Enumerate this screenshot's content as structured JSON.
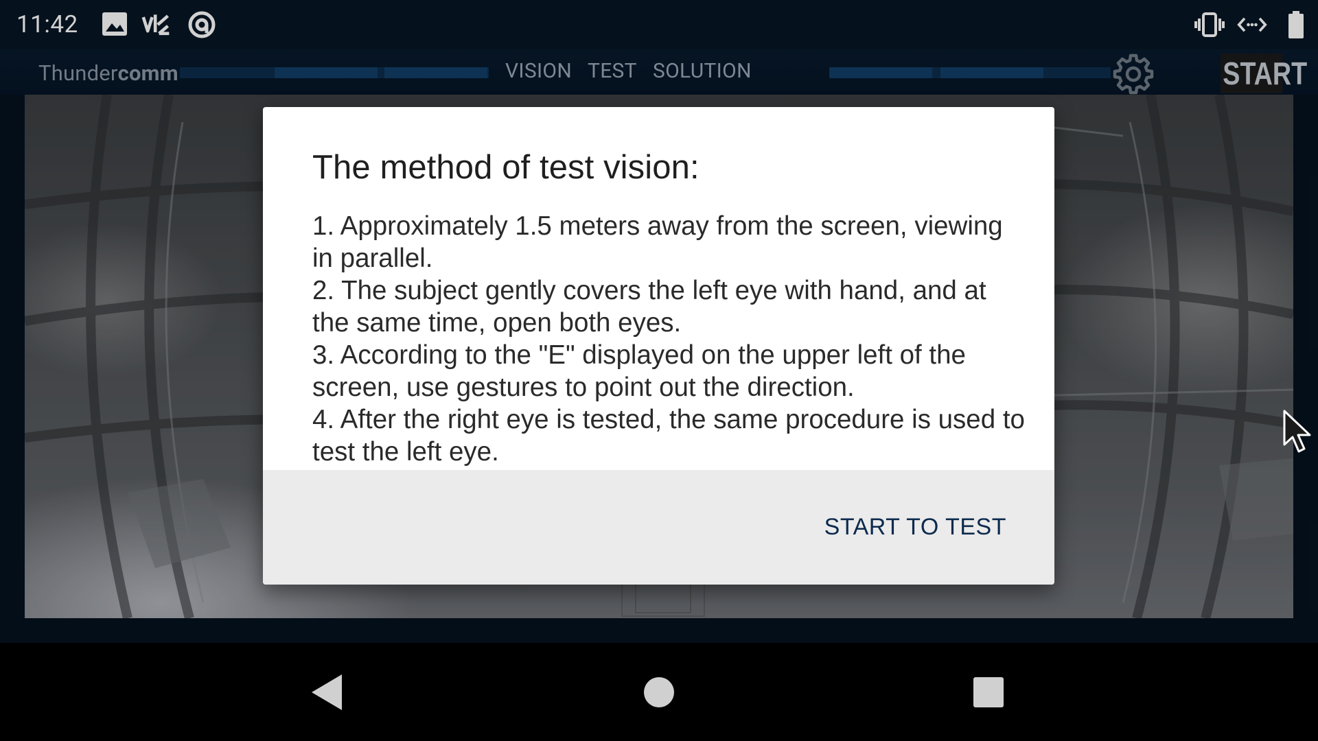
{
  "status_bar": {
    "time": "11:42",
    "left_icons": [
      "image-icon",
      "app-notification-icon",
      "at-sign-icon"
    ],
    "right_icons": [
      "vibrate-icon",
      "data-transfer-icon",
      "battery-icon"
    ]
  },
  "app_bar": {
    "brand_light": "Thunder",
    "brand_bold": "comm",
    "nav_items": [
      "VISION",
      "TEST",
      "SOLUTION"
    ],
    "settings_icon": "gear-icon",
    "start_label": "START"
  },
  "dialog": {
    "title": "The method of test vision:",
    "steps": [
      "1. Approximately 1.5 meters away from the screen, viewing in parallel.",
      "2. The subject gently covers the left eye with hand, and at the same time, open both eyes.",
      "3. According to the \"E\" displayed on the upper left of the screen, use gestures to point out the direction.",
      "4. After the right eye is tested, the same procedure is used to test the left eye."
    ],
    "action_label": "START TO TEST"
  },
  "navigation": {
    "back_icon": "back-triangle-icon",
    "home_icon": "home-circle-icon",
    "recents_icon": "recents-square-icon"
  },
  "colors": {
    "app_background": "#061426",
    "dialog_background": "#ffffff",
    "footer_background": "#ebebeb",
    "action_color": "#0c2a4d"
  }
}
